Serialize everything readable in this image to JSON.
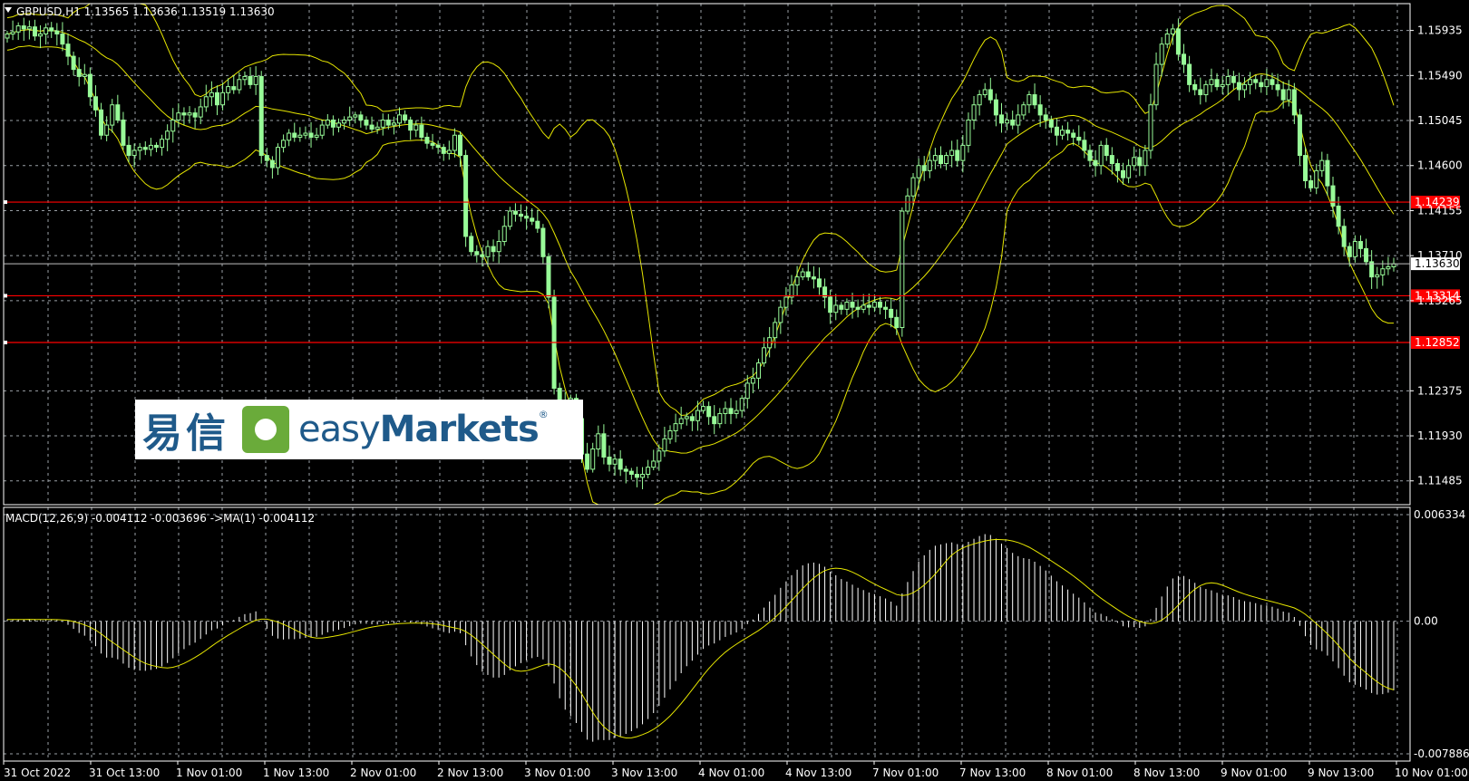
{
  "header": {
    "symbol_line": "GBPUSD,H1  1.13565 1.13636 1.13519 1.13630",
    "macd_line": "MACD(12,26,9) -0.004112 -0.003696  ->MA(1) -0.004112"
  },
  "logo": {
    "cn": "易信",
    "brand_light": "easy",
    "brand_bold": "Markets",
    "reg": "®"
  },
  "colors": {
    "background": "#000000",
    "grid": "#9aa0a6",
    "candle": "#98fb98",
    "band": "#e6e600",
    "level": "#ff0000",
    "macd_hist": "#ffffff",
    "signal": "#e6e600"
  },
  "chart_data": [
    {
      "type": "line",
      "name": "price",
      "ylim": [
        1.1125,
        1.162
      ],
      "yticks": [
        "1.15935",
        "1.15490",
        "1.15045",
        "1.14600",
        "1.14155",
        "1.13710",
        "1.13265",
        "1.12375",
        "1.11930",
        "1.11485"
      ],
      "ytick_values": [
        1.15935,
        1.1549,
        1.15045,
        1.146,
        1.14155,
        1.1371,
        1.13265,
        1.12375,
        1.1193,
        1.11485
      ],
      "current_price": "1.13630",
      "current_value": 1.1363,
      "levels": [
        {
          "label": "1.14239",
          "value": 1.14239
        },
        {
          "label": "1.13314",
          "value": 1.13314
        },
        {
          "label": "1.12852",
          "value": 1.12852
        }
      ],
      "close": [
        1.159,
        1.1592,
        1.1598,
        1.1595,
        1.1597,
        1.1588,
        1.159,
        1.1596,
        1.1593,
        1.159,
        1.158,
        1.1568,
        1.1555,
        1.1548,
        1.155,
        1.1528,
        1.1515,
        1.149,
        1.15,
        1.152,
        1.1505,
        1.148,
        1.147,
        1.1475,
        1.1478,
        1.1476,
        1.148,
        1.1478,
        1.1486,
        1.1494,
        1.1505,
        1.1512,
        1.151,
        1.1512,
        1.1508,
        1.1518,
        1.1528,
        1.1532,
        1.152,
        1.1532,
        1.1538,
        1.1535,
        1.1545,
        1.1548,
        1.154,
        1.1548,
        1.147,
        1.1465,
        1.1458,
        1.1478,
        1.1485,
        1.1492,
        1.1488,
        1.149,
        1.1492,
        1.1488,
        1.149,
        1.15,
        1.1505,
        1.1498,
        1.1502,
        1.1505,
        1.1508,
        1.151,
        1.1505,
        1.15,
        1.1496,
        1.1498,
        1.1505,
        1.15,
        1.1502,
        1.151,
        1.1505,
        1.1495,
        1.15,
        1.1488,
        1.1482,
        1.148,
        1.1478,
        1.1472,
        1.1475,
        1.149,
        1.147,
        1.139,
        1.1375,
        1.1372,
        1.137,
        1.138,
        1.1375,
        1.1385,
        1.14,
        1.1415,
        1.1412,
        1.141,
        1.1408,
        1.1405,
        1.1398,
        1.137,
        1.133,
        1.124,
        1.1225,
        1.122,
        1.123,
        1.121,
        1.1175,
        1.116,
        1.118,
        1.1195,
        1.1172,
        1.1165,
        1.117,
        1.116,
        1.1158,
        1.1155,
        1.1152,
        1.1155,
        1.1162,
        1.1168,
        1.1178,
        1.119,
        1.1198,
        1.1205,
        1.121,
        1.1212,
        1.1208,
        1.1218,
        1.1222,
        1.1212,
        1.1205,
        1.1215,
        1.122,
        1.1215,
        1.1218,
        1.123,
        1.1245,
        1.125,
        1.1265,
        1.128,
        1.129,
        1.1305,
        1.132,
        1.133,
        1.1342,
        1.135,
        1.1355,
        1.135,
        1.1348,
        1.134,
        1.133,
        1.1315,
        1.1322,
        1.1318,
        1.1325,
        1.132,
        1.1318,
        1.1322,
        1.132,
        1.1325,
        1.132,
        1.1318,
        1.131,
        1.13,
        1.1415,
        1.143,
        1.1448,
        1.146,
        1.1455,
        1.1465,
        1.147,
        1.1462,
        1.147,
        1.1475,
        1.1465,
        1.148,
        1.1505,
        1.152,
        1.153,
        1.1535,
        1.1525,
        1.151,
        1.1502,
        1.1505,
        1.15,
        1.151,
        1.152,
        1.153,
        1.152,
        1.151,
        1.1505,
        1.1498,
        1.149,
        1.1495,
        1.1492,
        1.1488,
        1.1485,
        1.1475,
        1.1465,
        1.146,
        1.148,
        1.147,
        1.1462,
        1.1455,
        1.1448,
        1.146,
        1.1468,
        1.146,
        1.1475,
        1.152,
        1.156,
        1.158,
        1.159,
        1.1595,
        1.157,
        1.156,
        1.154,
        1.1535,
        1.153,
        1.154,
        1.1545,
        1.1538,
        1.154,
        1.1548,
        1.1542,
        1.1535,
        1.154,
        1.1545,
        1.1542,
        1.1538,
        1.1545,
        1.154,
        1.1535,
        1.1525,
        1.1535,
        1.151,
        1.147,
        1.1445,
        1.1438,
        1.1455,
        1.1465,
        1.144,
        1.142,
        1.14,
        1.138,
        1.137,
        1.1385,
        1.1378,
        1.1365,
        1.135,
        1.1352,
        1.1358,
        1.136,
        1.1363
      ]
    },
    {
      "type": "bar",
      "name": "MACD(12,26,9)",
      "ylim": [
        -0.007886,
        0.006334
      ],
      "yticks": [
        "0.006334",
        "0.00",
        "-0.007886"
      ],
      "ytick_values": [
        0.006334,
        0.0,
        -0.007886
      ],
      "value": -0.004112,
      "signal": -0.003696
    }
  ],
  "xaxis": {
    "labels": [
      "31 Oct 2022",
      "31 Oct 13:00",
      "1 Nov 01:00",
      "1 Nov 13:00",
      "2 Nov 01:00",
      "2 Nov 13:00",
      "3 Nov 01:00",
      "3 Nov 13:00",
      "4 Nov 01:00",
      "4 Nov 13:00",
      "7 Nov 01:00",
      "7 Nov 13:00",
      "8 Nov 01:00",
      "8 Nov 13:00",
      "9 Nov 01:00",
      "9 Nov 13:00",
      "10 Nov 01:00"
    ]
  }
}
